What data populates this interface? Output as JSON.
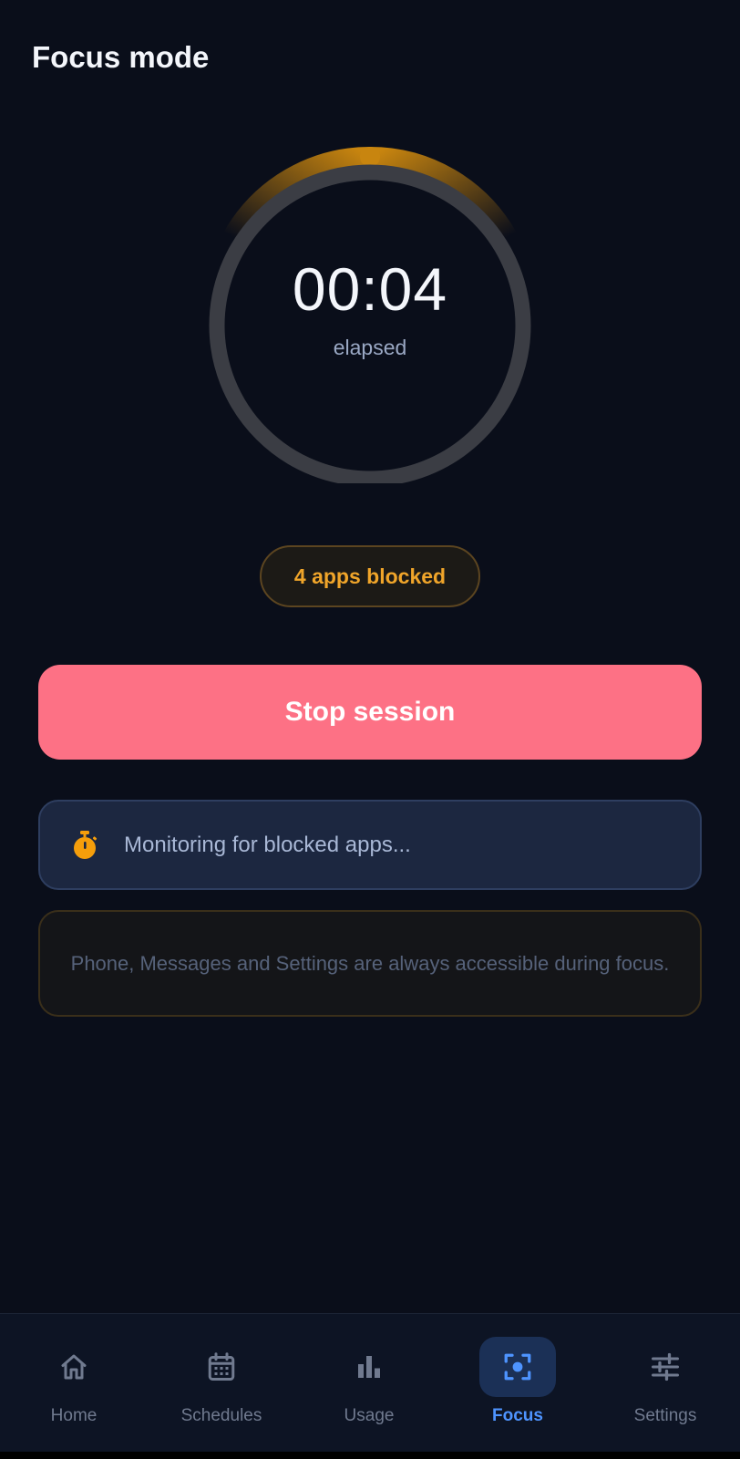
{
  "header": {
    "title": "Focus mode"
  },
  "timer": {
    "time": "00:04",
    "label": "elapsed",
    "accent_color": "#f59e0b",
    "track_color": "#3b3d44"
  },
  "status": {
    "apps_blocked_label": "4 apps blocked"
  },
  "actions": {
    "stop_label": "Stop session",
    "stop_color": "#fd7185"
  },
  "monitor": {
    "icon": "stopwatch-icon",
    "text": "Monitoring for blocked apps..."
  },
  "info": {
    "text": "Phone, Messages and Settings are always accessible during focus."
  },
  "nav": {
    "items": [
      {
        "label": "Home",
        "icon": "home-icon",
        "active": false
      },
      {
        "label": "Schedules",
        "icon": "calendar-icon",
        "active": false
      },
      {
        "label": "Usage",
        "icon": "bar-chart-icon",
        "active": false
      },
      {
        "label": "Focus",
        "icon": "focus-icon",
        "active": true
      },
      {
        "label": "Settings",
        "icon": "sliders-icon",
        "active": false
      }
    ]
  }
}
